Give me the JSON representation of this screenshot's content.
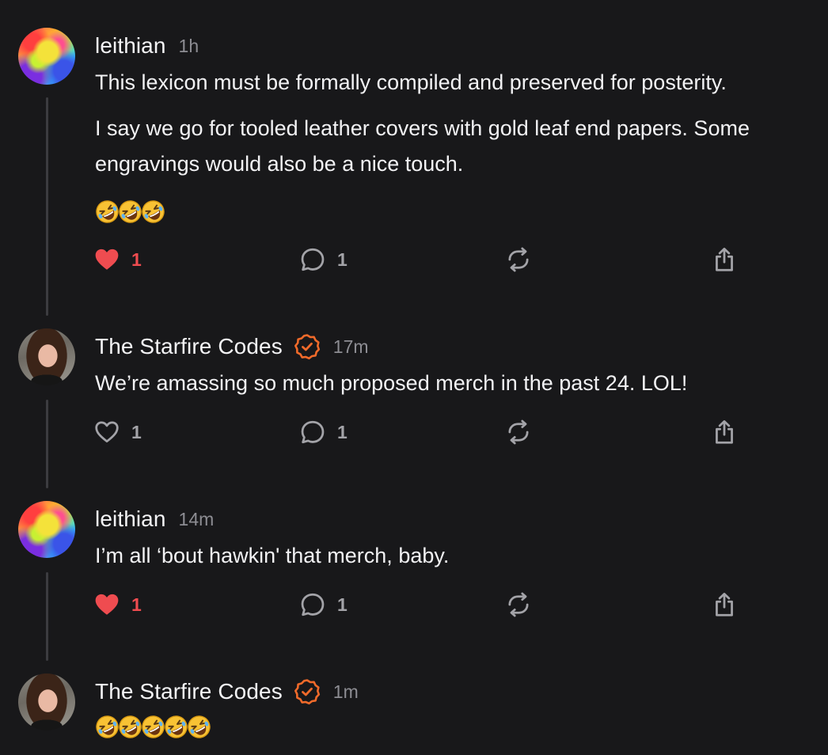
{
  "theme": {
    "background": "#18181a",
    "text": "#f2f2f4",
    "muted": "#8d8d93",
    "like_active": "#ef4c50",
    "verified": "#f06a2a",
    "thread_line": "#3c3c40"
  },
  "posts": [
    {
      "author": "leithian",
      "verified": false,
      "time": "1h",
      "paragraphs": [
        "This lexicon must be formally compiled and preserved for posterity.",
        "I say we go for tooled leather covers with gold leaf end papers. Some engravings would also be a nice touch."
      ],
      "emoji": [
        "rolling-on-floor-laughing",
        "rolling-on-floor-laughing",
        "rolling-on-floor-laughing"
      ],
      "likes": "1",
      "liked": true,
      "replies": "1"
    },
    {
      "author": "The Starfire Codes",
      "verified": true,
      "time": "17m",
      "paragraphs": [
        "We’re amassing so much proposed merch in the past 24. LOL!"
      ],
      "likes": "1",
      "liked": false,
      "replies": "1"
    },
    {
      "author": "leithian",
      "verified": false,
      "time": "14m",
      "paragraphs": [
        "I’m all ‘bout hawkin' that merch, baby."
      ],
      "likes": "1",
      "liked": true,
      "replies": "1"
    },
    {
      "author": "The Starfire Codes",
      "verified": true,
      "time": "1m",
      "emoji": [
        "rolling-on-floor-laughing",
        "rolling-on-floor-laughing",
        "rolling-on-floor-laughing",
        "rolling-on-floor-laughing",
        "rolling-on-floor-laughing"
      ]
    }
  ],
  "icons": {
    "like": "heart-icon",
    "reply": "speech-bubble-icon",
    "repost": "repost-arrows-icon",
    "share": "share-upload-icon",
    "verified": "verified-badge-icon",
    "emoji": "rolling-on-floor-laughing-emoji"
  }
}
